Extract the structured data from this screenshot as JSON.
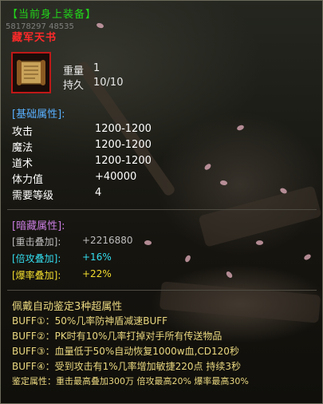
{
  "header": {
    "equipped_label": "【当前身上装备】",
    "id_line": "58178297 48535",
    "item_name": "藏军天书"
  },
  "item": {
    "icon": "scroll-icon",
    "weight_label": "重量",
    "weight_value": "1",
    "durability_label": "持久",
    "durability_value": "10/10"
  },
  "base_section": {
    "title": "[基础属性]:",
    "rows": [
      {
        "label": "攻击",
        "value": "1200-1200"
      },
      {
        "label": "魔法",
        "value": "1200-1200"
      },
      {
        "label": "道术",
        "value": "1200-1200"
      },
      {
        "label": "体力值",
        "value": "+40000"
      },
      {
        "label": "需要等级",
        "value": "4"
      }
    ]
  },
  "hidden_section": {
    "title": "[暗藏属性]:",
    "rows": [
      {
        "label": "[重击叠加]:",
        "value": "+2216880"
      },
      {
        "label": "[倍攻叠加]:",
        "value": "+16%"
      },
      {
        "label": "[爆率叠加]:",
        "value": "+22%"
      }
    ]
  },
  "description": {
    "lines": [
      "佩戴自动鉴定3种超属性",
      "BUFF①：50%几率防神盾减速BUFF",
      "BUFF②：PK时有10%几率打掉对手所有传送物品",
      "BUFF③：血量低于50%自动恢复1000w血,CD120秒",
      "BUFF④：受到攻击有1%几率增加敏捷220点 持续3秒",
      "鉴定属性：重击最高叠加300万 倍攻最高20% 爆率最高30%"
    ]
  },
  "colors": {
    "title_green": "#22d31a",
    "item_name_red": "#ff2a2a",
    "section_blue": "#58b0ff",
    "hidden_purple": "#c97de0",
    "desc_yellow": "#ead880"
  }
}
